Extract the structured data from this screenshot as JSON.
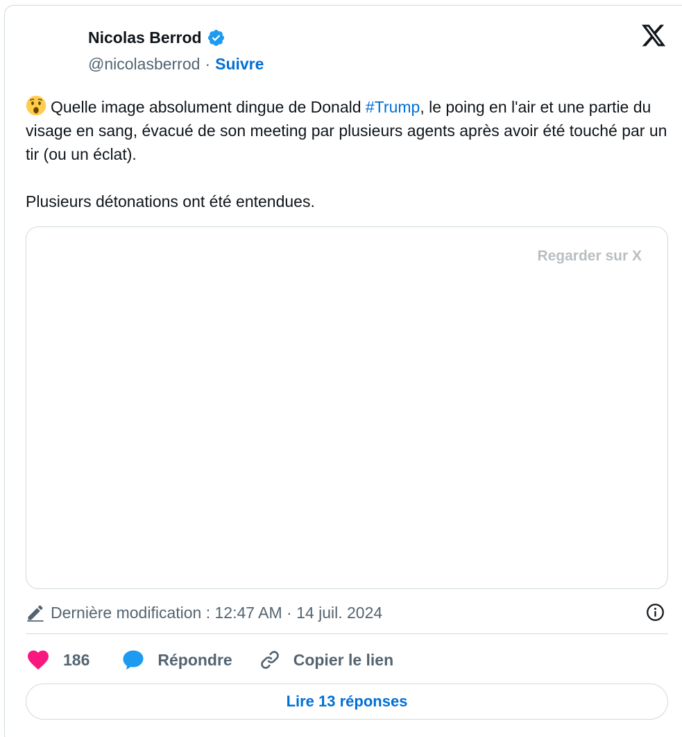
{
  "author": {
    "name": "Nicolas Berrod",
    "handle": "@nicolasberrod",
    "separator": "·",
    "follow_label": "Suivre"
  },
  "tweet": {
    "emoji": "astonished-face",
    "text_before_hashtag": "Quelle image absolument dingue de Donald ",
    "hashtag": "#Trump",
    "text_after_hashtag": ", le poing en l'air et une partie du visage en sang, évacué de son meeting par plusieurs agents après avoir été touché par un tir (ou un éclat).",
    "second_paragraph": "Plusieurs détonations ont été entendues."
  },
  "media": {
    "watch_label": "Regarder sur X"
  },
  "edited": {
    "label": "Dernière modification : 12:47 AM · 14 juil. 2024"
  },
  "actions": {
    "like_count": "186",
    "reply_label": "Répondre",
    "copy_link_label": "Copier le lien"
  },
  "footer": {
    "read_replies_label": "Lire 13 réponses"
  },
  "colors": {
    "link": "#006fd6",
    "verified": "#1d9bf0",
    "heart": "#f91880",
    "reply": "#1d9bf0",
    "muted": "#536471",
    "border": "#cfd9de"
  },
  "icons": [
    "verified-badge-icon",
    "x-logo-icon",
    "astonished-emoji-icon",
    "pencil-icon",
    "info-icon",
    "heart-icon",
    "reply-bubble-icon",
    "link-icon"
  ]
}
